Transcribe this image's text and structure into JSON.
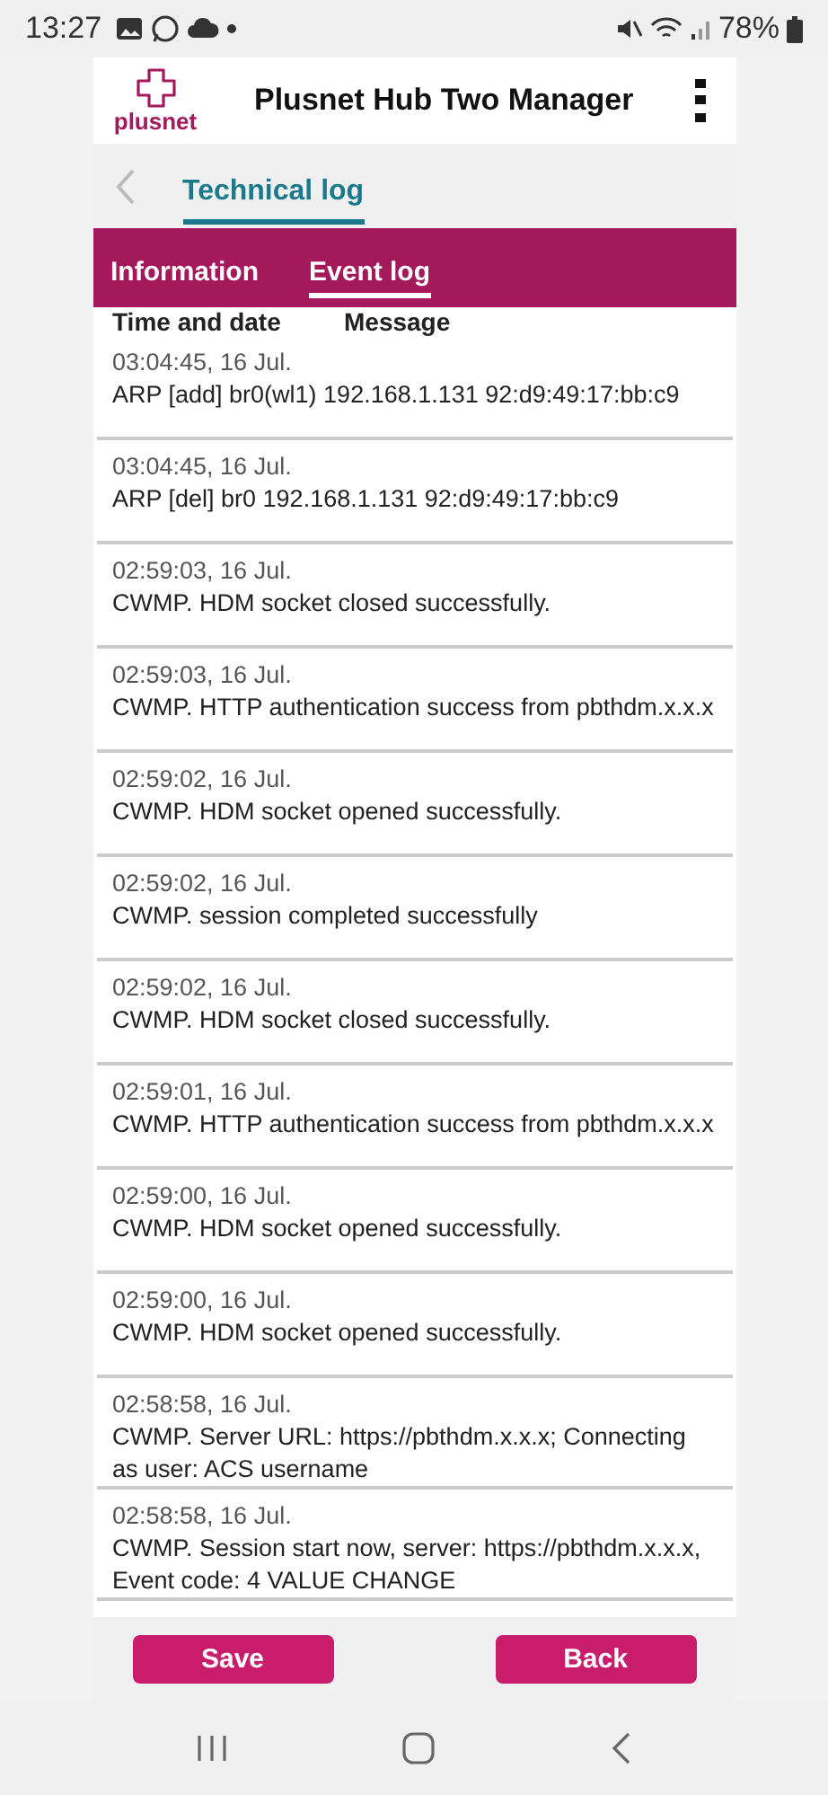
{
  "status_bar": {
    "time": "13:27",
    "battery": "78%"
  },
  "header": {
    "title": "Plusnet Hub Two Manager",
    "logo_text": "plusnet"
  },
  "subheader": {
    "title": "Technical log"
  },
  "tabs": [
    {
      "label": "Information",
      "selected": false
    },
    {
      "label": "Event log",
      "selected": true
    }
  ],
  "log": {
    "columns": [
      "Time and date",
      "Message"
    ],
    "entries": [
      {
        "time": "03:04:45, 16 Jul.",
        "message": "ARP [add] br0(wl1) 192.168.1.131 92:d9:49:17:bb:c9"
      },
      {
        "time": "03:04:45, 16 Jul.",
        "message": "ARP [del] br0 192.168.1.131 92:d9:49:17:bb:c9"
      },
      {
        "time": "02:59:03, 16 Jul.",
        "message": "CWMP. HDM socket closed successfully."
      },
      {
        "time": "02:59:03, 16 Jul.",
        "message": "CWMP. HTTP authentication success from pbthdm.x.x.x"
      },
      {
        "time": "02:59:02, 16 Jul.",
        "message": "CWMP. HDM socket opened successfully."
      },
      {
        "time": "02:59:02, 16 Jul.",
        "message": "CWMP. session completed successfully"
      },
      {
        "time": "02:59:02, 16 Jul.",
        "message": "CWMP. HDM socket closed successfully."
      },
      {
        "time": "02:59:01, 16 Jul.",
        "message": "CWMP. HTTP authentication success from pbthdm.x.x.x"
      },
      {
        "time": "02:59:00, 16 Jul.",
        "message": "CWMP. HDM socket opened successfully."
      },
      {
        "time": "02:59:00, 16 Jul.",
        "message": "CWMP. HDM socket opened successfully."
      },
      {
        "time": "02:58:58, 16 Jul.",
        "message": "CWMP. Server URL: https://pbthdm.x.x.x; Connecting as user: ACS username"
      },
      {
        "time": "02:58:58, 16 Jul.",
        "message": "CWMP. Session start now, server: https://pbthdm.x.x.x, Event code: 4 VALUE CHANGE"
      }
    ]
  },
  "buttons": [
    {
      "label": "Save"
    },
    {
      "label": "Back"
    }
  ]
}
